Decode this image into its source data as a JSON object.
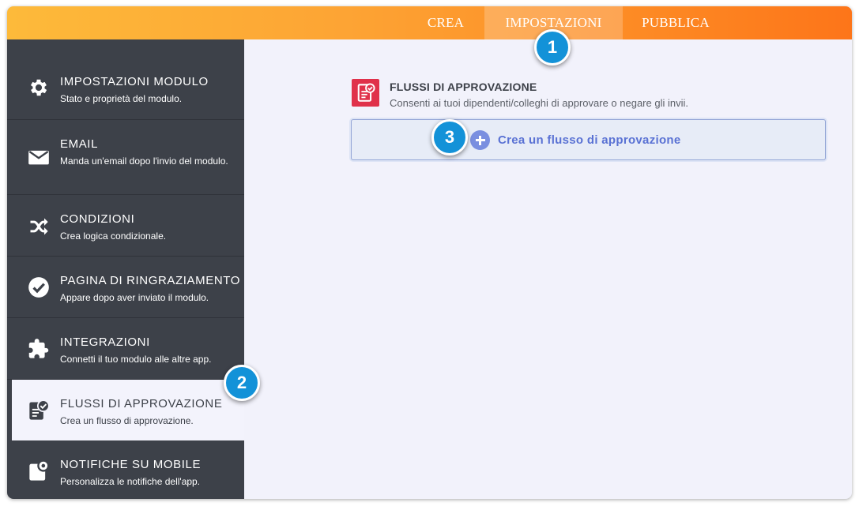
{
  "tabs": [
    {
      "label": "CREA",
      "active": false
    },
    {
      "label": "IMPOSTAZIONI",
      "active": true
    },
    {
      "label": "PUBBLICA",
      "active": false
    }
  ],
  "sidebar": {
    "items": [
      {
        "icon": "gear-icon",
        "title": "IMPOSTAZIONI MODULO",
        "desc": "Stato e proprietà del modulo."
      },
      {
        "icon": "envelope-icon",
        "title": "EMAIL",
        "desc": "Manda un'email dopo l'invio del modulo."
      },
      {
        "icon": "shuffle-icon",
        "title": "CONDIZIONI",
        "desc": "Crea logica condizionale."
      },
      {
        "icon": "check-circle-icon",
        "title": "PAGINA DI RINGRAZIAMENTO",
        "desc": "Appare dopo aver inviato il modulo."
      },
      {
        "icon": "puzzle-icon",
        "title": "INTEGRAZIONI",
        "desc": "Connetti il tuo modulo alle altre app."
      },
      {
        "icon": "approval-icon",
        "title": "FLUSSI DI APPROVAZIONE",
        "desc": "Crea un flusso di approvazione.",
        "active": true
      },
      {
        "icon": "mobile-notification-icon",
        "title": "NOTIFICHE SU MOBILE",
        "desc": "Personalizza le notifiche dell'app."
      }
    ]
  },
  "main": {
    "section_title": "FLUSSI DI APPROVAZIONE",
    "section_desc": "Consenti ai tuoi dipendenti/colleghi di approvare o negare gli invii.",
    "create_button_label": "Crea un flusso di approvazione"
  },
  "badges": [
    "1",
    "2",
    "3"
  ],
  "colors": {
    "topbar_start": "#fdba3a",
    "topbar_end": "#fd7519",
    "sidebar_bg": "#3d4149",
    "main_bg": "#f2f2fb",
    "section_icon_bg": "#e0314a",
    "button_text": "#5a72d4",
    "badge_bg": "#1392d8"
  }
}
